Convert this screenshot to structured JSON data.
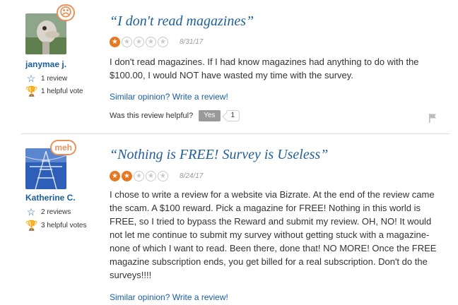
{
  "reviews": [
    {
      "username": "janymae j.",
      "mood": "☹",
      "review_count": "1 review",
      "helpful_votes": "1 helpful vote",
      "title": "“I don't read magazines”",
      "rating": 1,
      "rating_max": 5,
      "date": "8/31/17",
      "body": "I don't read magazines. If I had know magazines had anything to do with the $100.00, I would NOT have wasted my time with the survey.",
      "similar_link": "Similar opinion? Write a review!",
      "helpful_question": "Was this review helpful?",
      "yes_label": "Yes",
      "yes_count": "1"
    },
    {
      "username": "Katherine C.",
      "mood": "meh",
      "review_count": "2 reviews",
      "helpful_votes": "3 helpful votes",
      "title": "“Nothing is FREE! Survey is Useless”",
      "rating": 2,
      "rating_max": 5,
      "date": "8/24/17",
      "body": "I chose to write a review for a website via Bizrate. At the end of the review came the scam. A $100 reward. Pick a magazine for FREE! Nothing in this world is FREE, so I tried to bypass the Reward and submit my review. OH, NO! It would not let me continue to submit my survey without getting stuck with a magazine-none of which I want to read. Been there, done that! NO MORE! Once the FREE magazine subscription ends, you get billed for a real subscription. Don't do the surveys!!!!",
      "similar_link": "Similar opinion? Write a review!"
    }
  ],
  "colors": {
    "accent_orange": "#e87722",
    "link_blue": "#1a5fa0",
    "title_blue": "#1f5f98"
  }
}
